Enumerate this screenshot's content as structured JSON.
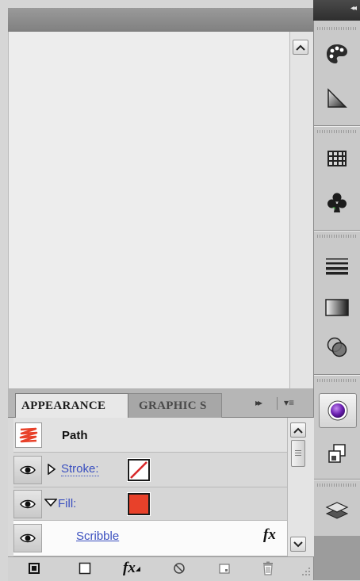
{
  "dock": {
    "collapse_glyph": "◂◂",
    "buttons": [
      {
        "name": "color-palette-icon",
        "active": false
      },
      {
        "name": "color-guide-icon",
        "active": false
      },
      {
        "name": "swatches-icon",
        "active": false
      },
      {
        "name": "symbols-icon",
        "active": false
      },
      {
        "name": "stroke-icon",
        "active": false
      },
      {
        "name": "gradient-icon",
        "active": false
      },
      {
        "name": "transparency-icon",
        "active": false
      },
      {
        "name": "appearance-icon",
        "active": true
      },
      {
        "name": "graphic-styles-icon",
        "active": false
      },
      {
        "name": "layers-icon",
        "active": false
      }
    ]
  },
  "appearance_panel": {
    "tabs": [
      {
        "label": "APPEARANCE",
        "active": true
      },
      {
        "label": "GRAPHIC S",
        "active": false
      }
    ],
    "tab_controls": {
      "forward": "▸▸",
      "menu": "▾≡"
    },
    "object_label": "Path",
    "rows": [
      {
        "type": "stroke",
        "label": "Stroke:",
        "expanded": false,
        "swatch": "none"
      },
      {
        "type": "fill",
        "label": "Fill:",
        "expanded": true,
        "swatch": "#e8412a"
      },
      {
        "type": "effect",
        "label": "Scribble",
        "fx_glyph": "fx"
      }
    ],
    "bottom_toolbar": [
      "add-new-stroke-icon",
      "add-new-fill-icon",
      "add-new-effect-icon",
      "clear-appearance-icon",
      "duplicate-item-icon",
      "delete-item-icon"
    ],
    "bottom_fx_glyph": "fx"
  },
  "colors": {
    "fill_red": "#e8412a",
    "stroke_slash": "#d8282a",
    "link_blue": "#3a4fbf",
    "appearance_purple": "#6a1fb0"
  }
}
